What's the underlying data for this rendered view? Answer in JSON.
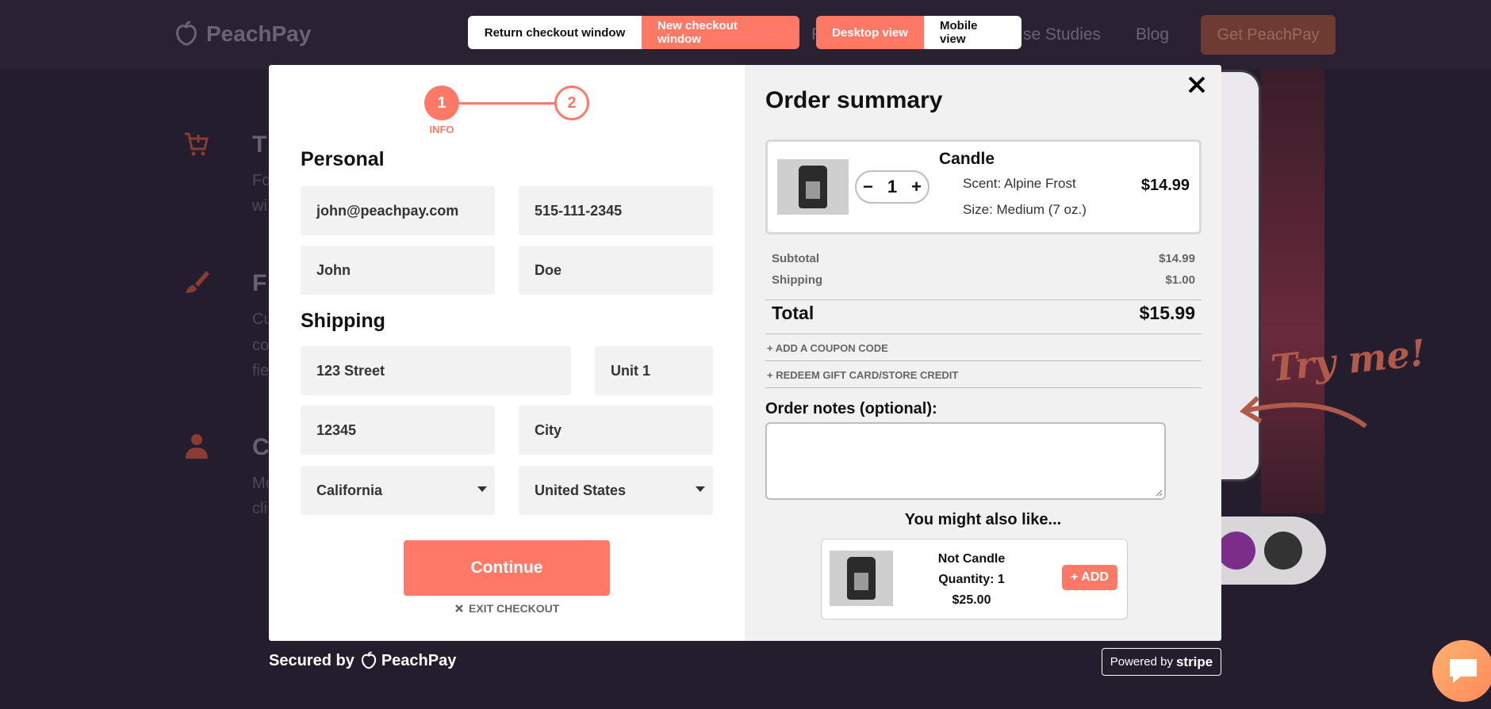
{
  "background": {
    "logo_text": "PeachPay",
    "nav": [
      "se Studies",
      "Blog"
    ],
    "nav_partial_left": "F",
    "get_button": "Get PeachPay",
    "features": [
      {
        "letter": "T",
        "lines": [
          "Fo",
          "wi"
        ]
      },
      {
        "letter": "F",
        "lines": [
          "Cu",
          "co",
          "fie"
        ]
      },
      {
        "letter": "C",
        "lines": [
          "Mo",
          "cli"
        ]
      }
    ],
    "try_me": "Try me!",
    "accent_color": "#ff7966"
  },
  "toggles": {
    "checkout": [
      {
        "label": "Return checkout window",
        "active": false
      },
      {
        "label": "New checkout window",
        "active": true
      }
    ],
    "view": [
      {
        "label": "Desktop view",
        "active": true
      },
      {
        "label": "Mobile view",
        "active": false
      }
    ]
  },
  "steps": {
    "step1": "1",
    "step1_label": "INFO",
    "step2": "2"
  },
  "personal": {
    "title": "Personal",
    "email": "john@peachpay.com",
    "phone": "515-111-2345",
    "first_name": "John",
    "last_name": "Doe"
  },
  "shipping": {
    "title": "Shipping",
    "street": "123 Street",
    "unit": "Unit 1",
    "zip": "12345",
    "city_placeholder": "City",
    "state": "California",
    "country": "United States"
  },
  "actions": {
    "continue": "Continue",
    "exit": "EXIT CHECKOUT"
  },
  "summary": {
    "title": "Order summary",
    "item": {
      "name": "Candle",
      "quantity": "1",
      "scent": "Scent: Alpine Frost",
      "size": "Size: Medium (7 oz.)",
      "price": "$14.99"
    },
    "subtotal_label": "Subtotal",
    "subtotal_value": "$14.99",
    "shipping_label": "Shipping",
    "shipping_value": "$1.00",
    "total_label": "Total",
    "total_value": "$15.99",
    "coupon_link": "+ ADD A COUPON CODE",
    "gift_link": "+ REDEEM GIFT CARD/STORE CREDIT",
    "notes_label": "Order notes (optional):"
  },
  "upsell": {
    "title": "You might also like...",
    "name": "Not Candle",
    "quantity": "Quantity: 1",
    "price": "$25.00",
    "add_label": "+ ADD"
  },
  "footer": {
    "secured_by": "Secured by",
    "brand": "PeachPay",
    "powered_by": "Powered by",
    "stripe": "stripe"
  }
}
